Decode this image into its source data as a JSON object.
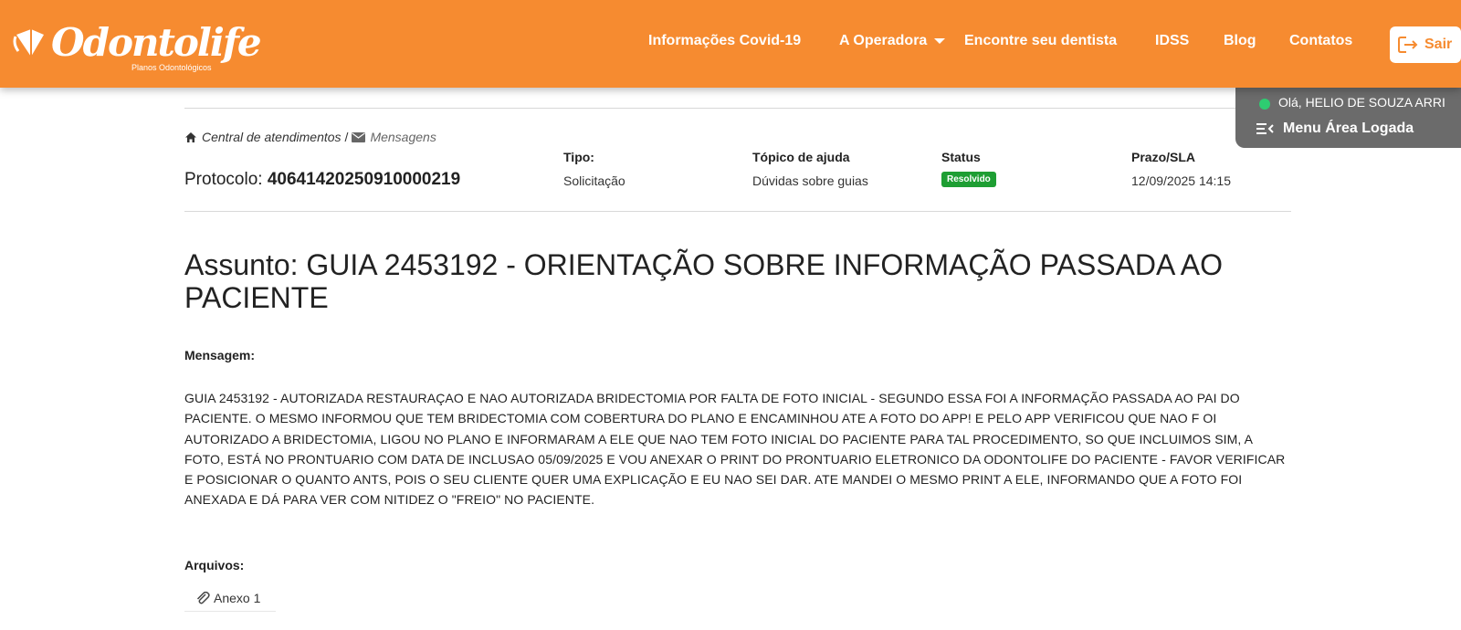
{
  "header": {
    "logo_text": "Odontolife",
    "logo_subtitle": "Planos Odontológicos",
    "nav": {
      "covid": "Informações Covid-19",
      "operadora": "A Operadora",
      "dentista": "Encontre seu dentista",
      "idss": "IDSS",
      "blog": "Blog",
      "contatos": "Contatos"
    },
    "logout_label": "Sair"
  },
  "user_panel": {
    "greeting": "Olá, HELIO DE SOUZA ARRI",
    "menu_label": "Menu Área Logada"
  },
  "breadcrumb": {
    "parent": "Central de atendimentos",
    "separator": "/",
    "current": "Mensagens"
  },
  "ticket": {
    "protocolo_label": "Protocolo:",
    "protocolo_number": "40641420250910000219",
    "tipo_label": "Tipo:",
    "tipo_value": "Solicitação",
    "topico_label": "Tópico de ajuda",
    "topico_value": "Dúvidas sobre guias",
    "status_label": "Status",
    "status_value": "Resolvido",
    "prazo_label": "Prazo/SLA",
    "prazo_value": "12/09/2025 14:15"
  },
  "assunto": "Assunto: GUIA 2453192 - ORIENTAÇÃO SOBRE INFORMAÇÃO PASSADA AO PACIENTE",
  "mensagem_label": "Mensagem:",
  "mensagem_text": "GUIA 2453192 - AUTORIZADA RESTAURAÇAO E NAO AUTORIZADA BRIDECTOMIA POR FALTA DE FOTO INICIAL - SEGUNDO ESSA FOI A INFORMAÇÃO PASSADA AO PAI DO PACIENTE. O MESMO INFORMOU QUE TEM BRIDECTOMIA COM COBERTURA DO PLANO E ENCAMINHOU ATE A FOTO DO APP! E PELO APP VERIFICOU QUE NAO F OI AUTORIZADO A BRIDECTOMIA, LIGOU NO PLANO E INFORMARAM A ELE QUE NAO TEM FOTO INICIAL DO PACIENTE PARA TAL PROCEDIMENTO, SO QUE INCLUIMOS SIM, A FOTO, ESTÁ NO PRONTUARIO COM DATA DE INCLUSAO 05/09/2025 E VOU ANEXAR O PRINT DO PRONTUARIO ELETRONICO DA ODONTOLIFE DO PACIENTE - FAVOR VERIFICAR E POSICIONAR O QUANTO ANTS, POIS O SEU CLIENTE QUER UMA EXPLICAÇÃO E EU NAO SEI DAR. ATE MANDEI O MESMO PRINT A ELE, INFORMANDO QUE A FOTO FOI ANEXADA E DÁ PARA VER COM NITIDEZ O \"FREIO\" NO PACIENTE.",
  "arquivos_label": "Arquivos:",
  "attachments": [
    "Anexo 1"
  ],
  "colors": {
    "brand_orange": "#f68b30",
    "status_green": "#1e9e33",
    "online_dot": "#2ecc71",
    "panel_gray": "#6b6b6b"
  },
  "icons": {
    "logo": "tooth-logo-icon",
    "caret": "chevron-down-icon",
    "logout": "logout-icon",
    "menu": "menu-lines-icon",
    "home": "home-icon",
    "mail": "envelope-icon",
    "attachment": "paperclip-icon"
  }
}
